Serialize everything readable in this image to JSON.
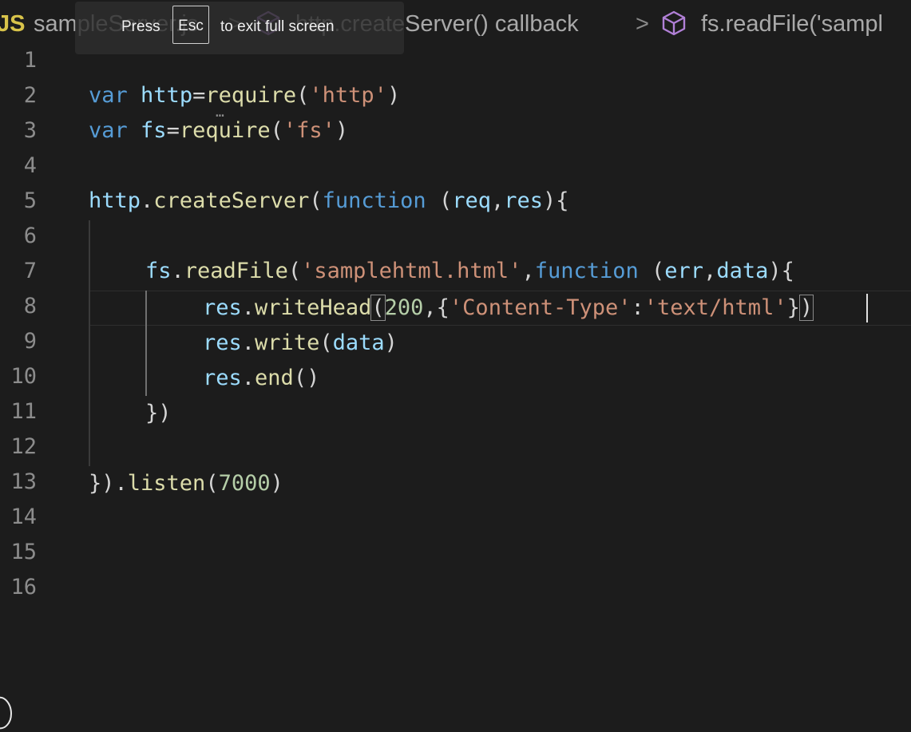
{
  "breadcrumb": {
    "lang": "JS",
    "file": "sampleServer.js",
    "separator": ">",
    "callback": "http.createServer() callback",
    "current": "fs.readFile('sampl",
    "icon": "symbol-method-icon"
  },
  "toast": {
    "press": "Press",
    "key": "Esc",
    "rest": "to exit full screen"
  },
  "editor": {
    "line_numbers": [
      "1",
      "2",
      "3",
      "4",
      "5",
      "6",
      "7",
      "8",
      "9",
      "10",
      "11",
      "12",
      "13",
      "14",
      "15",
      "16"
    ],
    "lines": {
      "l2": {
        "a": "var",
        "b": "http",
        "c": "=",
        "d": "require",
        "e": "(",
        "f": "'http'",
        "g": ")"
      },
      "l3": {
        "a": "var",
        "b": "fs",
        "c": "=",
        "d": "require",
        "e": "(",
        "f": "'fs'",
        "g": ")"
      },
      "l5": {
        "a": "http",
        "b": ".",
        "c": "createServer",
        "d": "(",
        "e": "function",
        "f": " (",
        "g": "req",
        "h": ",",
        "i": "res",
        "j": "){"
      },
      "l7": {
        "a": "fs",
        "b": ".",
        "c": "readFile",
        "d": "(",
        "e": "'samplehtml.html'",
        "f": ",",
        "g": "function",
        "h": " (",
        "i": "err",
        "j": ",",
        "k": "data",
        "l": "){"
      },
      "l8": {
        "a": "res",
        "b": ".",
        "c": "writeHead",
        "d": "(",
        "e": "200",
        "f": ",{",
        "g": "'Content-Type'",
        "h": ":",
        "i": "'text/html'",
        "j": "}",
        "k": ")"
      },
      "l9": {
        "a": "res",
        "b": ".",
        "c": "write",
        "d": "(",
        "e": "data",
        "f": ")"
      },
      "l10": {
        "a": "res",
        "b": ".",
        "c": "end",
        "d": "()"
      },
      "l11": {
        "a": "})"
      },
      "l13": {
        "a": "})",
        "b": ".",
        "c": "listen",
        "d": "(",
        "e": "7000",
        "f": ")"
      }
    }
  },
  "colors": {
    "background": "#1c1c1c",
    "keyword": "#569cd6",
    "variable": "#9cdcfe",
    "function": "#dcdcaa",
    "string": "#ce9178",
    "number": "#b5cea8"
  }
}
